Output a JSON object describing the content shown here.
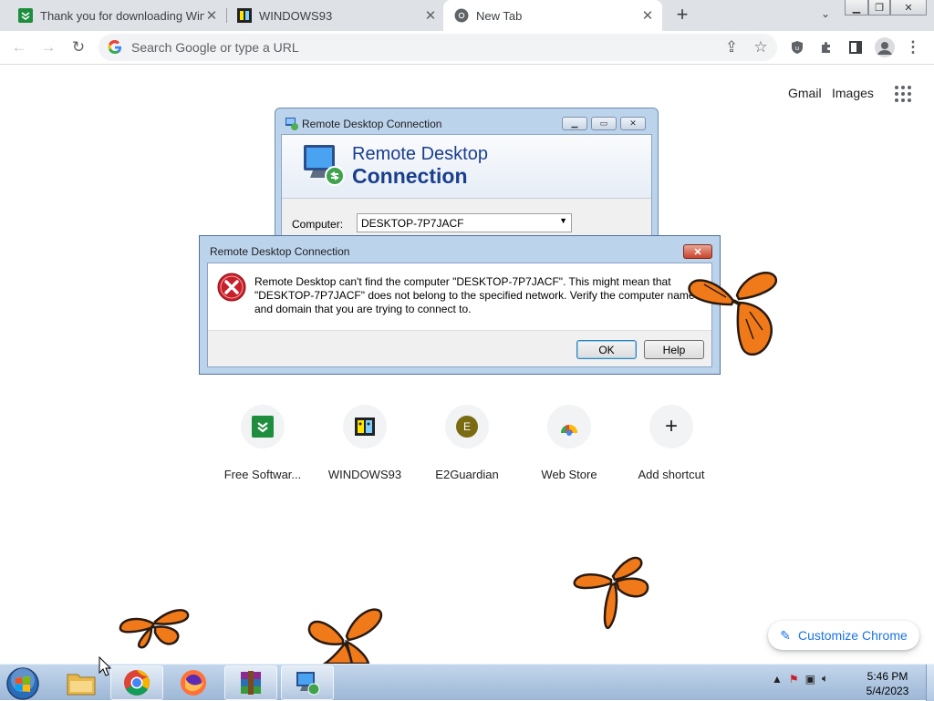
{
  "browser": {
    "tabs": [
      {
        "title": "Thank you for downloading WinRAR",
        "active": false
      },
      {
        "title": "WINDOWS93",
        "active": false
      },
      {
        "title": "New Tab",
        "active": true
      }
    ],
    "omnibox_placeholder": "Search Google or type a URL"
  },
  "ntp": {
    "gmail_link": "Gmail",
    "images_link": "Images",
    "shortcuts": [
      {
        "label": "Free Softwar...",
        "icon": "free-software-icon"
      },
      {
        "label": "WINDOWS93",
        "icon": "windows93-icon"
      },
      {
        "label": "E2Guardian",
        "icon": "e2guardian-icon",
        "letter": "E"
      },
      {
        "label": "Web Store",
        "icon": "web-store-icon"
      },
      {
        "label": "Add shortcut",
        "icon": "plus-icon"
      }
    ],
    "customize_label": "Customize Chrome"
  },
  "rdc_window": {
    "title": "Remote Desktop Connection",
    "heading_line1": "Remote Desktop",
    "heading_line2": "Connection",
    "computer_label": "Computer:",
    "computer_value": "DESKTOP-7P7JACF"
  },
  "error_dialog": {
    "title": "Remote Desktop Connection",
    "message": "Remote Desktop can't find the computer \"DESKTOP-7P7JACF\". This might mean that \"DESKTOP-7P7JACF\" does not belong to the specified network.  Verify the computer name and domain that you are trying to connect to.",
    "ok_label": "OK",
    "help_label": "Help"
  },
  "taskbar": {
    "items": [
      "start-button",
      "explorer",
      "chrome",
      "firefox",
      "winrar",
      "remote-desktop"
    ],
    "clock_time": "5:46 PM",
    "clock_date": "5/4/2023"
  },
  "colors": {
    "tabstrip": "#dee1e6",
    "link_blue": "#1a73e8",
    "rdc_heading": "#1a3f8e",
    "error_red": "#c8202a",
    "butterfly_orange": "#f07a1a"
  }
}
